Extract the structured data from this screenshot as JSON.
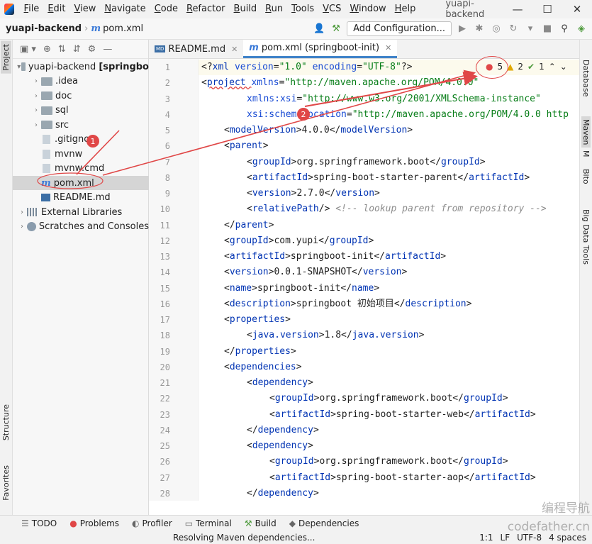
{
  "menubar": {
    "items": [
      "File",
      "Edit",
      "View",
      "Navigate",
      "Code",
      "Refactor",
      "Build",
      "Run",
      "Tools",
      "VCS",
      "Window",
      "Help"
    ],
    "window_title": "yuapi-backend"
  },
  "navbar": {
    "project": "yuapi-backend",
    "file": "pom.xml",
    "add_config": "Add Configuration..."
  },
  "left_strip": {
    "project": "Project",
    "structure": "Structure",
    "favorites": "Favorites"
  },
  "right_strip": {
    "database": "Database",
    "maven": "Maven",
    "bito": "Bito",
    "bigdata": "Big Data Tools",
    "m": "M"
  },
  "tree": [
    {
      "label": "yuapi-backend [springbo",
      "icon": "folder",
      "expanded": true,
      "indent": 0
    },
    {
      "label": ".idea",
      "icon": "folder",
      "expanded": false,
      "indent": 1
    },
    {
      "label": "doc",
      "icon": "folder",
      "expanded": false,
      "indent": 1
    },
    {
      "label": "sql",
      "icon": "folder",
      "expanded": false,
      "indent": 1
    },
    {
      "label": "src",
      "icon": "folder",
      "expanded": false,
      "indent": 1
    },
    {
      "label": ".gitignore",
      "icon": "file",
      "indent": 1
    },
    {
      "label": "mvnw",
      "icon": "file",
      "indent": 1
    },
    {
      "label": "mvnw.cmd",
      "icon": "file",
      "indent": 1
    },
    {
      "label": "pom.xml",
      "icon": "m",
      "indent": 1,
      "selected": true
    },
    {
      "label": "README.md",
      "icon": "md",
      "indent": 1
    },
    {
      "label": "External Libraries",
      "icon": "lib",
      "expanded": false,
      "indent": 0
    },
    {
      "label": "Scratches and Consoles",
      "icon": "scratch",
      "expanded": false,
      "indent": 0
    }
  ],
  "tabs": [
    {
      "label": "README.md",
      "icon": "md",
      "active": false
    },
    {
      "label": "pom.xml (springboot-init)",
      "icon": "m",
      "active": true
    }
  ],
  "inspections": {
    "errors": "5",
    "warnings": "2",
    "ok": "1"
  },
  "code_lines": [
    {
      "n": "1",
      "indent": 0,
      "parts": [
        [
          "p",
          "<?"
        ],
        [
          "t",
          "xml "
        ],
        [
          "a",
          "version"
        ],
        [
          "p",
          "="
        ],
        [
          "s",
          "\"1.0\" "
        ],
        [
          "a",
          "encoding"
        ],
        [
          "p",
          "="
        ],
        [
          "s",
          "\"UTF-8\""
        ],
        [
          "p",
          "?>"
        ]
      ]
    },
    {
      "n": "2",
      "indent": 0,
      "parts": [
        [
          "p",
          "<"
        ],
        [
          "t",
          "project "
        ],
        [
          "a",
          "xmlns"
        ],
        [
          "p",
          "="
        ],
        [
          "s",
          "\"http://maven.apache.org/POM/4.0.0\""
        ]
      ]
    },
    {
      "n": "3",
      "indent": 2,
      "parts": [
        [
          "a",
          "xmlns:xsi"
        ],
        [
          "p",
          "="
        ],
        [
          "s",
          "\"http://www.w3.org/2001/XMLSchema-instance\""
        ]
      ]
    },
    {
      "n": "4",
      "indent": 2,
      "parts": [
        [
          "a",
          "xsi:schemaLocation"
        ],
        [
          "p",
          "="
        ],
        [
          "s",
          "\"http://maven.apache.org/POM/4.0.0 http"
        ]
      ]
    },
    {
      "n": "5",
      "indent": 1,
      "parts": [
        [
          "p",
          "<"
        ],
        [
          "t",
          "modelVersion"
        ],
        [
          "p",
          ">4.0.0</"
        ],
        [
          "t",
          "modelVersion"
        ],
        [
          "p",
          ">"
        ]
      ]
    },
    {
      "n": "6",
      "indent": 1,
      "parts": [
        [
          "p",
          "<"
        ],
        [
          "t",
          "parent"
        ],
        [
          "p",
          ">"
        ]
      ]
    },
    {
      "n": "7",
      "indent": 2,
      "parts": [
        [
          "p",
          "<"
        ],
        [
          "t",
          "groupId"
        ],
        [
          "p",
          ">org.springframework.boot</"
        ],
        [
          "t",
          "groupId"
        ],
        [
          "p",
          ">"
        ]
      ]
    },
    {
      "n": "8",
      "indent": 2,
      "parts": [
        [
          "p",
          "<"
        ],
        [
          "t",
          "artifactId"
        ],
        [
          "p",
          ">spring-boot-starter-parent</"
        ],
        [
          "t",
          "artifactId"
        ],
        [
          "p",
          ">"
        ]
      ]
    },
    {
      "n": "9",
      "indent": 2,
      "parts": [
        [
          "p",
          "<"
        ],
        [
          "t",
          "version"
        ],
        [
          "p",
          ">2.7.0</"
        ],
        [
          "t",
          "version"
        ],
        [
          "p",
          ">"
        ]
      ]
    },
    {
      "n": "10",
      "indent": 2,
      "parts": [
        [
          "p",
          "<"
        ],
        [
          "t",
          "relativePath"
        ],
        [
          "p",
          "/> "
        ],
        [
          "c",
          "<!-- lookup parent from repository -->"
        ]
      ]
    },
    {
      "n": "11",
      "indent": 1,
      "parts": [
        [
          "p",
          "</"
        ],
        [
          "t",
          "parent"
        ],
        [
          "p",
          ">"
        ]
      ]
    },
    {
      "n": "12",
      "indent": 1,
      "parts": [
        [
          "p",
          "<"
        ],
        [
          "t",
          "groupId"
        ],
        [
          "p",
          ">com.yupi</"
        ],
        [
          "t",
          "groupId"
        ],
        [
          "p",
          ">"
        ]
      ]
    },
    {
      "n": "13",
      "indent": 1,
      "parts": [
        [
          "p",
          "<"
        ],
        [
          "t",
          "artifactId"
        ],
        [
          "p",
          ">springboot-init</"
        ],
        [
          "t",
          "artifactId"
        ],
        [
          "p",
          ">"
        ]
      ]
    },
    {
      "n": "14",
      "indent": 1,
      "parts": [
        [
          "p",
          "<"
        ],
        [
          "t",
          "version"
        ],
        [
          "p",
          ">0.0.1-SNAPSHOT</"
        ],
        [
          "t",
          "version"
        ],
        [
          "p",
          ">"
        ]
      ]
    },
    {
      "n": "15",
      "indent": 1,
      "parts": [
        [
          "p",
          "<"
        ],
        [
          "t",
          "name"
        ],
        [
          "p",
          ">springboot-init</"
        ],
        [
          "t",
          "name"
        ],
        [
          "p",
          ">"
        ]
      ]
    },
    {
      "n": "16",
      "indent": 1,
      "parts": [
        [
          "p",
          "<"
        ],
        [
          "t",
          "description"
        ],
        [
          "p",
          ">springboot 初始项目</"
        ],
        [
          "t",
          "description"
        ],
        [
          "p",
          ">"
        ]
      ]
    },
    {
      "n": "17",
      "indent": 1,
      "parts": [
        [
          "p",
          "<"
        ],
        [
          "t",
          "properties"
        ],
        [
          "p",
          ">"
        ]
      ]
    },
    {
      "n": "18",
      "indent": 2,
      "parts": [
        [
          "p",
          "<"
        ],
        [
          "t",
          "java.version"
        ],
        [
          "p",
          ">1.8</"
        ],
        [
          "t",
          "java.version"
        ],
        [
          "p",
          ">"
        ]
      ]
    },
    {
      "n": "19",
      "indent": 1,
      "parts": [
        [
          "p",
          "</"
        ],
        [
          "t",
          "properties"
        ],
        [
          "p",
          ">"
        ]
      ]
    },
    {
      "n": "20",
      "indent": 1,
      "parts": [
        [
          "p",
          "<"
        ],
        [
          "t",
          "dependencies"
        ],
        [
          "p",
          ">"
        ]
      ]
    },
    {
      "n": "21",
      "indent": 2,
      "parts": [
        [
          "p",
          "<"
        ],
        [
          "t",
          "dependency"
        ],
        [
          "p",
          ">"
        ]
      ]
    },
    {
      "n": "22",
      "indent": 3,
      "parts": [
        [
          "p",
          "<"
        ],
        [
          "t",
          "groupId"
        ],
        [
          "p",
          ">org.springframework.boot</"
        ],
        [
          "t",
          "groupId"
        ],
        [
          "p",
          ">"
        ]
      ]
    },
    {
      "n": "23",
      "indent": 3,
      "parts": [
        [
          "p",
          "<"
        ],
        [
          "t",
          "artifactId"
        ],
        [
          "p",
          ">spring-boot-starter-web</"
        ],
        [
          "t",
          "artifactId"
        ],
        [
          "p",
          ">"
        ]
      ]
    },
    {
      "n": "24",
      "indent": 2,
      "parts": [
        [
          "p",
          "</"
        ],
        [
          "t",
          "dependency"
        ],
        [
          "p",
          ">"
        ]
      ]
    },
    {
      "n": "25",
      "indent": 2,
      "parts": [
        [
          "p",
          "<"
        ],
        [
          "t",
          "dependency"
        ],
        [
          "p",
          ">"
        ]
      ]
    },
    {
      "n": "26",
      "indent": 3,
      "parts": [
        [
          "p",
          "<"
        ],
        [
          "t",
          "groupId"
        ],
        [
          "p",
          ">org.springframework.boot</"
        ],
        [
          "t",
          "groupId"
        ],
        [
          "p",
          ">"
        ]
      ]
    },
    {
      "n": "27",
      "indent": 3,
      "parts": [
        [
          "p",
          "<"
        ],
        [
          "t",
          "artifactId"
        ],
        [
          "p",
          ">spring-boot-starter-aop</"
        ],
        [
          "t",
          "artifactId"
        ],
        [
          "p",
          ">"
        ]
      ]
    },
    {
      "n": "28",
      "indent": 2,
      "parts": [
        [
          "p",
          "</"
        ],
        [
          "t",
          "dependency"
        ],
        [
          "p",
          ">"
        ]
      ]
    }
  ],
  "bottom_tools": [
    "TODO",
    "Problems",
    "Profiler",
    "Terminal",
    "Build",
    "Dependencies"
  ],
  "status": {
    "message": "Resolving Maven dependencies...",
    "position": "1:1",
    "line_sep": "LF",
    "encoding": "UTF-8",
    "indent": "4 spaces"
  },
  "annotations": {
    "step1": "1",
    "step2": "2"
  },
  "watermark": {
    "line1": "编程导航",
    "line2": "codefather.cn"
  },
  "colors": {
    "accent": "#4083c9",
    "annotation": "#e04747",
    "tag": "#0033b3",
    "string": "#067d17"
  }
}
